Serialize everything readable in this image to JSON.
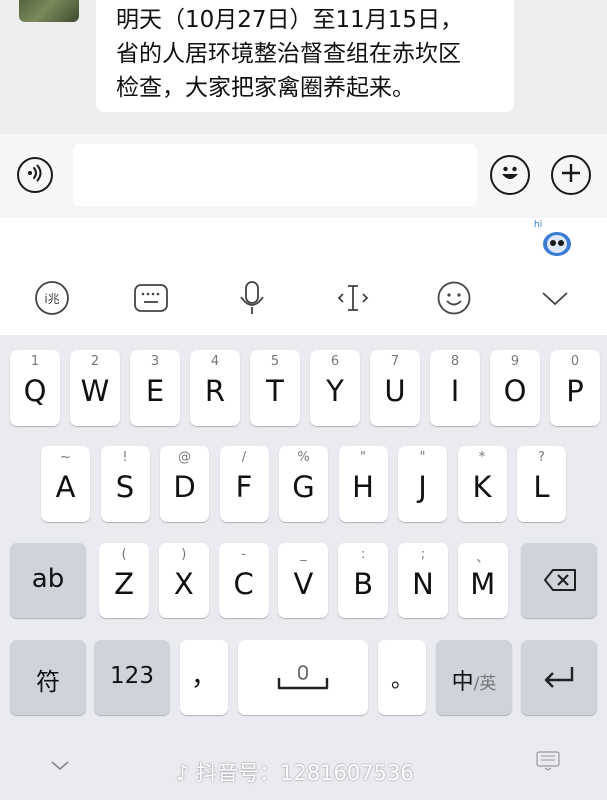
{
  "message": {
    "lines": [
      "明天（10月27日）至11月15日，",
      "省的人居环境整治督查组在赤坎区",
      "检查，大家把家禽圈养起来。"
    ]
  },
  "input_bar": {
    "voice_icon": "voice-icon",
    "emoji_icon": "emoji-icon",
    "plus_icon": "plus-icon",
    "text_value": ""
  },
  "toolbar": {
    "hi_label": "hi",
    "tools": [
      "handwriting-icon",
      "keyboard-icon",
      "microphone-icon",
      "cursor-icon",
      "emoji-icon",
      "collapse-icon"
    ]
  },
  "keyboard": {
    "row1": [
      {
        "main": "Q",
        "sub": "1"
      },
      {
        "main": "W",
        "sub": "2"
      },
      {
        "main": "E",
        "sub": "3"
      },
      {
        "main": "R",
        "sub": "4"
      },
      {
        "main": "T",
        "sub": "5"
      },
      {
        "main": "Y",
        "sub": "6"
      },
      {
        "main": "U",
        "sub": "7"
      },
      {
        "main": "I",
        "sub": "8"
      },
      {
        "main": "O",
        "sub": "9"
      },
      {
        "main": "P",
        "sub": "0"
      }
    ],
    "row2": [
      {
        "main": "A",
        "sub": "~"
      },
      {
        "main": "S",
        "sub": "!"
      },
      {
        "main": "D",
        "sub": "@"
      },
      {
        "main": "F",
        "sub": "/"
      },
      {
        "main": "G",
        "sub": "%"
      },
      {
        "main": "H",
        "sub": "\""
      },
      {
        "main": "J",
        "sub": "\""
      },
      {
        "main": "K",
        "sub": "*"
      },
      {
        "main": "L",
        "sub": "?"
      }
    ],
    "row3": [
      {
        "main": "Z",
        "sub": "("
      },
      {
        "main": "X",
        "sub": ")"
      },
      {
        "main": "C",
        "sub": "-"
      },
      {
        "main": "V",
        "sub": "_"
      },
      {
        "main": "B",
        "sub": ":"
      },
      {
        "main": "N",
        "sub": ";"
      },
      {
        "main": "M",
        "sub": "、"
      }
    ],
    "shift_label": "ab",
    "symbols_label": "符",
    "numbers_label": "123",
    "comma_label": "，",
    "period_label": "。",
    "lang_primary": "中",
    "lang_secondary": "/英",
    "backspace_icon": "backspace-icon",
    "enter_icon": "enter-icon",
    "space_icon": "space-mic-icon"
  },
  "watermark": {
    "text": "抖音号：1281607536"
  }
}
